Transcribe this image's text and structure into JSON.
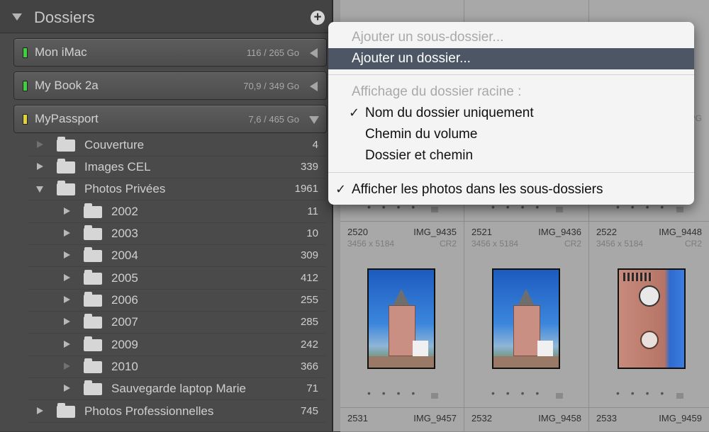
{
  "panel": {
    "title": "Dossiers",
    "add_button": "+",
    "volumes": [
      {
        "name": "Mon iMac",
        "size": "116 / 265 Go",
        "led_color": "#3fcf3f",
        "expanded": false
      },
      {
        "name": "My Book 2a",
        "size": "70,9 / 349 Go",
        "led_color": "#3fcf3f",
        "expanded": false
      },
      {
        "name": "MyPassport",
        "size": "7,6 / 465 Go",
        "led_color": "#e0d23a",
        "expanded": true
      }
    ],
    "folders": [
      {
        "name": "Couverture",
        "count": "4"
      },
      {
        "name": "Images CEL",
        "count": "339"
      },
      {
        "name": "Photos Privées",
        "count": "1961"
      },
      {
        "name": "2002",
        "count": "11"
      },
      {
        "name": "2003",
        "count": "10"
      },
      {
        "name": "2004",
        "count": "309"
      },
      {
        "name": "2005",
        "count": "412"
      },
      {
        "name": "2006",
        "count": "255"
      },
      {
        "name": "2007",
        "count": "285"
      },
      {
        "name": "2009",
        "count": "242"
      },
      {
        "name": "2010",
        "count": "366"
      },
      {
        "name": "Sauvegarde laptop Marie",
        "count": "71"
      },
      {
        "name": "Photos Professionnelles",
        "count": "745"
      }
    ]
  },
  "menu": {
    "add_subfolder": "Ajouter un sous-dossier...",
    "add_folder": "Ajouter un dossier...",
    "root_display_header": "Affichage du dossier racine :",
    "folder_name_only": "Nom du dossier uniquement",
    "volume_path": "Chemin du volume",
    "folder_and_path": "Dossier et chemin",
    "show_photos_in_subfolders": "Afficher les photos dans les sous-dossiers",
    "check_mark": "✓"
  },
  "grid": {
    "row1": [
      {
        "number": "2520",
        "filename": "IMG_9435",
        "dimensions": "3456 x 5184",
        "ext": "CR2"
      },
      {
        "number": "2521",
        "filename": "IMG_9436",
        "dimensions": "3456 x 5184",
        "ext": "CR2"
      },
      {
        "number": "2522",
        "filename": "IMG_9448",
        "dimensions": "3456 x 5184",
        "ext": "CR2"
      }
    ],
    "row2": [
      {
        "number": "2531",
        "filename": "IMG_9457"
      },
      {
        "number": "2532",
        "filename": "IMG_9458"
      },
      {
        "number": "2533",
        "filename": "IMG_9459"
      }
    ],
    "top_ext": "PG",
    "dots": "• • • •"
  }
}
